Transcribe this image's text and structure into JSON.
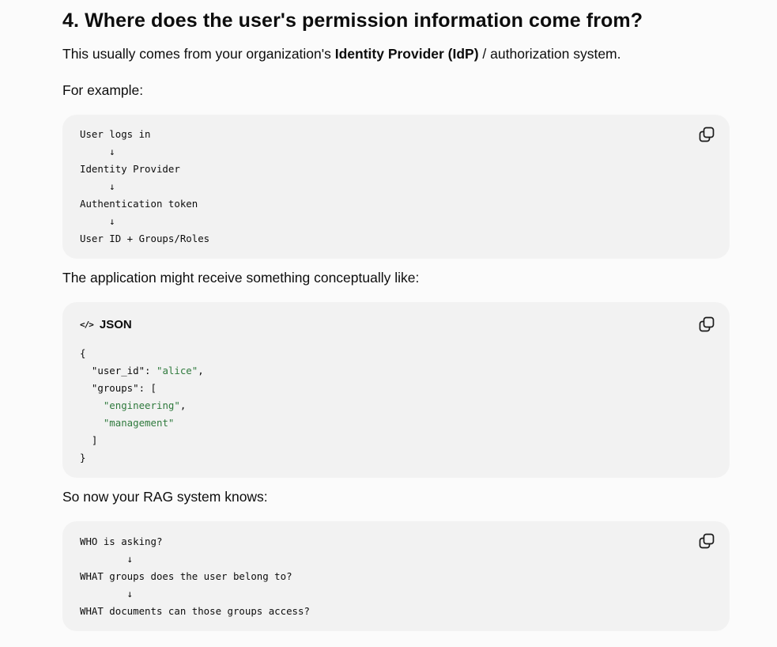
{
  "heading": "4. Where does the user's permission information come from?",
  "intro": {
    "before": "This usually comes from your organization's ",
    "bold": "Identity Provider (IdP)",
    "after": " / authorization system."
  },
  "for_example": "For example:",
  "flow_block": {
    "lines": [
      "User logs in",
      "     ↓",
      "Identity Provider",
      "     ↓",
      "Authentication token",
      "     ↓",
      "User ID + Groups/Roles"
    ]
  },
  "app_receives": "The application might receive something conceptually like:",
  "json_block": {
    "language": "JSON",
    "lang_icon": "</>",
    "lines": [
      {
        "pre": "{",
        "str": "",
        "post": ""
      },
      {
        "pre": "  \"user_id\": ",
        "str": "\"alice\"",
        "post": ","
      },
      {
        "pre": "  \"groups\": [",
        "str": "",
        "post": ""
      },
      {
        "pre": "    ",
        "str": "\"engineering\"",
        "post": ","
      },
      {
        "pre": "    ",
        "str": "\"management\"",
        "post": ""
      },
      {
        "pre": "  ]",
        "str": "",
        "post": ""
      },
      {
        "pre": "}",
        "str": "",
        "post": ""
      }
    ]
  },
  "rag_knows": "So now your RAG system knows:",
  "rag_block": {
    "lines": [
      "WHO is asking?",
      "        ↓",
      "WHAT groups does the user belong to?",
      "        ↓",
      "WHAT documents can those groups access?"
    ]
  },
  "icons": {
    "copy": "copy-icon",
    "code": "code-icon"
  }
}
